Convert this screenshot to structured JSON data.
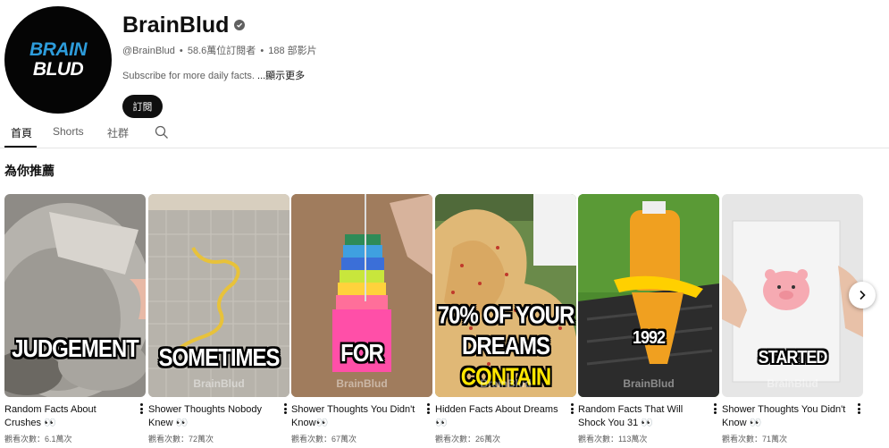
{
  "channel": {
    "avatar_line1": "BRAIN",
    "avatar_line2": "BLUD",
    "name": "BrainBlud",
    "handle": "@BrainBlud",
    "subscribers": "58.6萬位訂閱者",
    "videos": "188 部影片",
    "description": "Subscribe for more daily facts.",
    "more_label": "...顯示更多",
    "subscribe_label": "訂閱"
  },
  "tabs": [
    {
      "label": "首頁",
      "active": true
    },
    {
      "label": "Shorts",
      "active": false
    },
    {
      "label": "社群",
      "active": false
    }
  ],
  "section": {
    "title": "為你推薦"
  },
  "shorts": [
    {
      "title": "Random Facts About Crushes 👀",
      "views": "觀看次數：6.1萬次",
      "overlay": "JUDGEMENT"
    },
    {
      "title": "Shower Thoughts Nobody Knew 👀",
      "views": "觀看次數：72萬次",
      "overlay": "SOMETIMES",
      "watermark": "BrainBlud"
    },
    {
      "title": "Shower Thoughts You Didn't Know👀",
      "views": "觀看次數：67萬次",
      "overlay": "FOR",
      "watermark": "BrainBlud"
    },
    {
      "title": "Hidden Facts About Dreams 👀",
      "views": "觀看次數：26萬次",
      "overlay_l1": "70% OF YOUR",
      "overlay_l2": "DREAMS",
      "overlay_l3": "CONTAIN",
      "watermark": "BrainBlud"
    },
    {
      "title": "Random Facts That Will Shock You 31 👀",
      "views": "觀看次數：113萬次",
      "overlay": "1992",
      "watermark": "BrainBlud"
    },
    {
      "title": "Shower Thoughts You Didn't Know 👀",
      "views": "觀看次數：71萬次",
      "overlay": "STARTED",
      "watermark": "BrainBlud"
    }
  ],
  "colors": {
    "avatar_accent": "#2d9cdb",
    "overlay_highlight": "#ffe600",
    "primary_text": "#0f0f0f",
    "secondary_text": "#606060"
  },
  "icons": {
    "verified": "verified-check-icon",
    "search": "search-icon",
    "more": "more-vert-icon",
    "next": "chevron-right-icon"
  }
}
